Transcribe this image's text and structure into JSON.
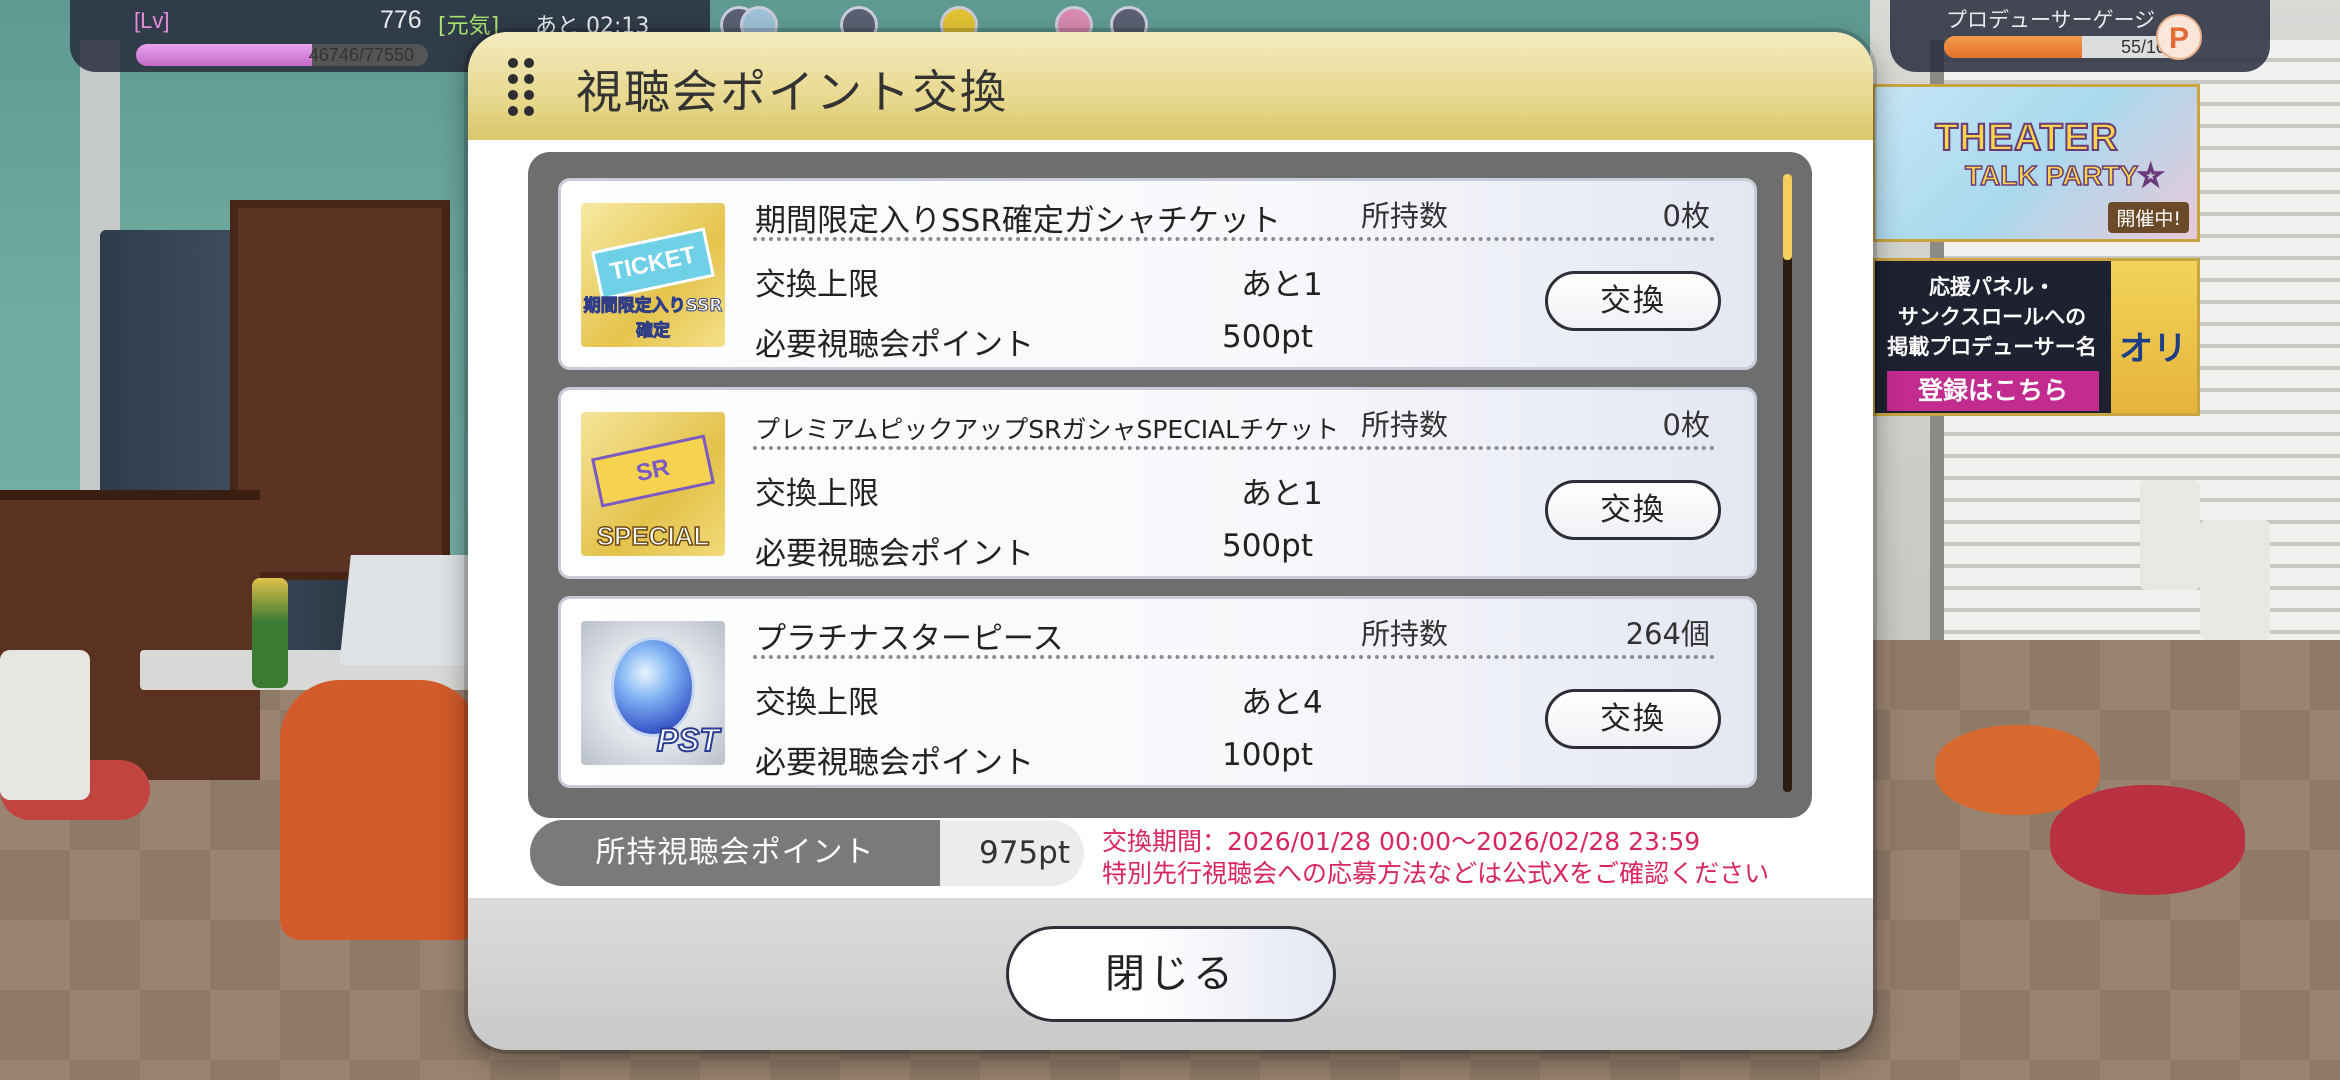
{
  "hud": {
    "level_tag": "[Lv]",
    "level": "776",
    "genki_tag": "[元気]",
    "recovery_time": "あと 02:13",
    "exp_text": "46746/77550",
    "exp_ratio": 0.603,
    "producer_gauge_label": "プロデューサーゲージ",
    "producer_gauge_text": "55/100",
    "producer_gauge_ratio": 0.55,
    "producer_gauge_icon": "P"
  },
  "banners": {
    "theater": {
      "title_line1": "THEATER",
      "title_line2": "TALK PARTY☆",
      "tag": "開催中!"
    },
    "support_panel": {
      "line1": "応援パネル・",
      "line2": "サンクスロールへの",
      "line3": "掲載プロデューサー名",
      "button": "登録はこちら",
      "side_text": "オリ"
    }
  },
  "dialog": {
    "title": "視聴会ポイント交換",
    "items": [
      {
        "name": "期間限定入りSSR確定ガシャチケット",
        "icon": "ssr-ticket-icon",
        "icon_main_text": "TICKET",
        "icon_caption": "期間限定入りSSR確定",
        "owned_label": "所持数",
        "owned": "0枚",
        "limit_label": "交換上限",
        "limit": "あと1",
        "cost_label": "必要視聴会ポイント",
        "cost": "500pt",
        "button": "交換"
      },
      {
        "name": "プレミアムピックアップSRガシャSPECIALチケット",
        "icon": "sr-special-ticket-icon",
        "icon_main_text": "SR",
        "icon_caption": "SPECIAL",
        "owned_label": "所持数",
        "owned": "0枚",
        "limit_label": "交換上限",
        "limit": "あと1",
        "cost_label": "必要視聴会ポイント",
        "cost": "500pt",
        "button": "交換"
      },
      {
        "name": "プラチナスターピース",
        "icon": "platinum-star-piece-icon",
        "icon_caption": "PST",
        "owned_label": "所持数",
        "owned": "264個",
        "limit_label": "交換上限",
        "limit": "あと4",
        "cost_label": "必要視聴会ポイント",
        "cost": "100pt",
        "button": "交換"
      }
    ],
    "points_label": "所持視聴会ポイント",
    "points_value": "975pt",
    "notice_line1": "交換期間：2026/01/28 00:00〜2026/02/28 23:59",
    "notice_line2": "特別先行視聴会への応募方法などは公式Xをご確認ください",
    "close_button": "閉じる"
  },
  "colors": {
    "header_gold": "#e8d98f",
    "notice_pink": "#d8265f",
    "panel_gray": "#6e6e6e",
    "scroll_thumb": "#f4cf5e"
  }
}
